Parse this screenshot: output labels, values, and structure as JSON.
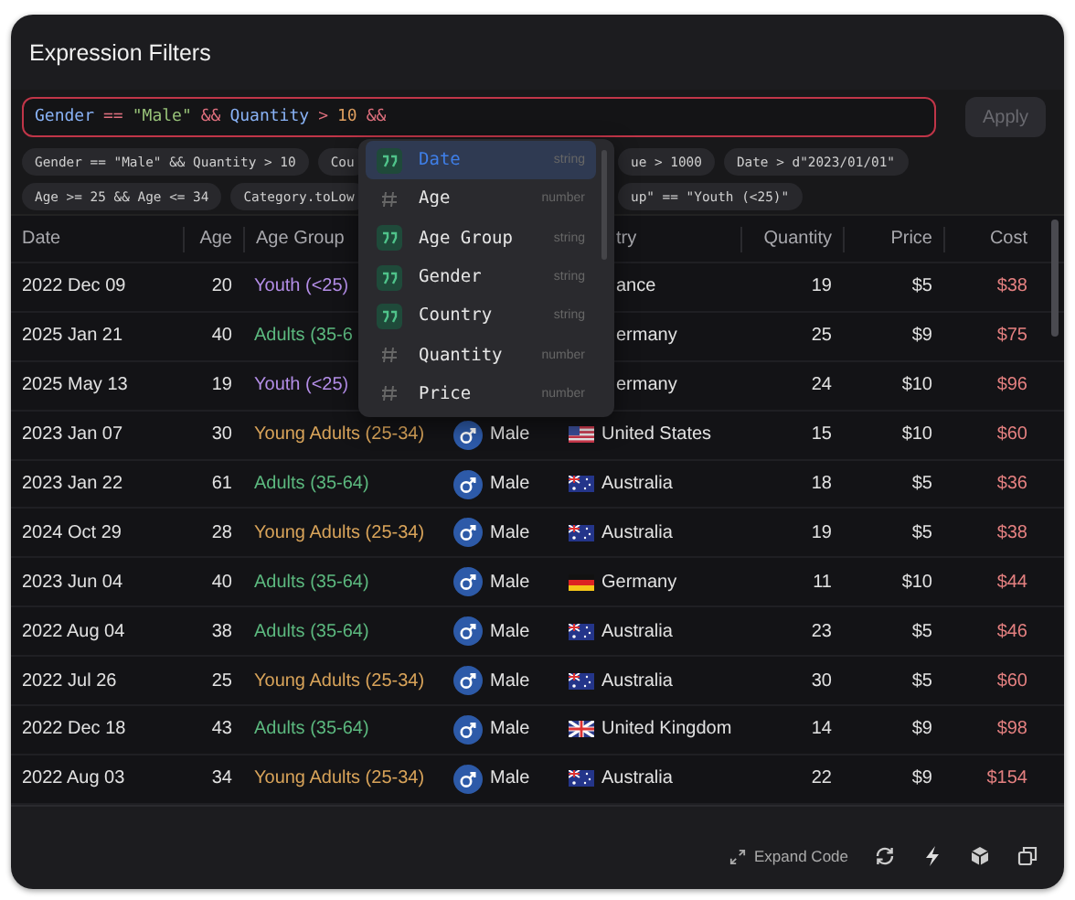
{
  "window": {
    "title": "Expression Filters"
  },
  "expression": {
    "error": true,
    "tokens": [
      {
        "kind": "field",
        "text": "Gender"
      },
      {
        "kind": "op",
        "text": "=="
      },
      {
        "kind": "string",
        "text": "\"Male\""
      },
      {
        "kind": "op",
        "text": "&&"
      },
      {
        "kind": "field",
        "text": "Quantity"
      },
      {
        "kind": "op",
        "text": ">"
      },
      {
        "kind": "number",
        "text": "10"
      },
      {
        "kind": "op",
        "text": "&&"
      }
    ]
  },
  "apply_button": {
    "label": "Apply",
    "disabled": true
  },
  "chip_rows": [
    {
      "left": [
        "Gender == \"Male\" && Quantity > 10",
        "Cou"
      ],
      "right": [
        "ue > 1000",
        "Date > d\"2023/01/01\""
      ]
    },
    {
      "left": [
        "Age >= 25 && Age <= 34",
        "Category.toLow"
      ],
      "right": [
        "up\" == \"Youth (<25)\""
      ]
    }
  ],
  "suggestions": [
    {
      "label": "Date",
      "type": "string",
      "selected": true
    },
    {
      "label": "Age",
      "type": "number",
      "selected": false
    },
    {
      "label": "Age Group",
      "type": "string",
      "selected": false
    },
    {
      "label": "Gender",
      "type": "string",
      "selected": false
    },
    {
      "label": "Country",
      "type": "string",
      "selected": false
    },
    {
      "label": "Quantity",
      "type": "number",
      "selected": false
    },
    {
      "label": "Price",
      "type": "number",
      "selected": false
    }
  ],
  "table": {
    "columns": [
      "Date",
      "Age",
      "Age Group",
      "try",
      "Quantity",
      "Price",
      "Cost"
    ],
    "rows": [
      {
        "date": "2022 Dec 09",
        "age": "20",
        "group": "Youth (<25)",
        "color": "#b48ee8",
        "country": {
          "name": "ance"
        },
        "quantity": "19",
        "price": "$5",
        "cost": "$38"
      },
      {
        "date": "2025 Jan 21",
        "age": "40",
        "group": "Adults (35-6",
        "color": "#5cb97f",
        "country": {
          "name": "ermany"
        },
        "quantity": "25",
        "price": "$9",
        "cost": "$75"
      },
      {
        "date": "2025 May 13",
        "age": "19",
        "group": "Youth (<25)",
        "color": "#b48ee8",
        "country": {
          "name": "ermany"
        },
        "quantity": "24",
        "price": "$10",
        "cost": "$96"
      },
      {
        "date": "2023 Jan 07",
        "age": "30",
        "group": "Young Adults (25-34)",
        "color": "#d9a45a",
        "gender": "Male",
        "country": {
          "kind": "us",
          "name": "United States"
        },
        "quantity": "15",
        "price": "$10",
        "cost": "$60"
      },
      {
        "date": "2023 Jan 22",
        "age": "61",
        "group": "Adults (35-64)",
        "color": "#5cb97f",
        "gender": "Male",
        "country": {
          "kind": "au",
          "name": "Australia"
        },
        "quantity": "18",
        "price": "$5",
        "cost": "$36"
      },
      {
        "date": "2024 Oct 29",
        "age": "28",
        "group": "Young Adults (25-34)",
        "color": "#d9a45a",
        "gender": "Male",
        "country": {
          "kind": "au",
          "name": "Australia"
        },
        "quantity": "19",
        "price": "$5",
        "cost": "$38"
      },
      {
        "date": "2023 Jun 04",
        "age": "40",
        "group": "Adults (35-64)",
        "color": "#5cb97f",
        "gender": "Male",
        "country": {
          "kind": "de",
          "name": "Germany"
        },
        "quantity": "11",
        "price": "$10",
        "cost": "$44"
      },
      {
        "date": "2022 Aug 04",
        "age": "38",
        "group": "Adults (35-64)",
        "color": "#5cb97f",
        "gender": "Male",
        "country": {
          "kind": "au",
          "name": "Australia"
        },
        "quantity": "23",
        "price": "$5",
        "cost": "$46"
      },
      {
        "date": "2022 Jul 26",
        "age": "25",
        "group": "Young Adults (25-34)",
        "color": "#d9a45a",
        "gender": "Male",
        "country": {
          "kind": "au",
          "name": "Australia"
        },
        "quantity": "30",
        "price": "$5",
        "cost": "$60"
      },
      {
        "date": "2022 Dec 18",
        "age": "43",
        "group": "Adults (35-64)",
        "color": "#5cb97f",
        "gender": "Male",
        "country": {
          "kind": "gb",
          "name": "United Kingdom"
        },
        "quantity": "14",
        "price": "$9",
        "cost": "$98"
      },
      {
        "date": "2022 Aug 03",
        "age": "34",
        "group": "Young Adults (25-34)",
        "color": "#d9a45a",
        "gender": "Male",
        "country": {
          "kind": "au",
          "name": "Australia"
        },
        "quantity": "22",
        "price": "$9",
        "cost": "$154"
      }
    ]
  },
  "footer": {
    "expand_label": "Expand Code"
  }
}
